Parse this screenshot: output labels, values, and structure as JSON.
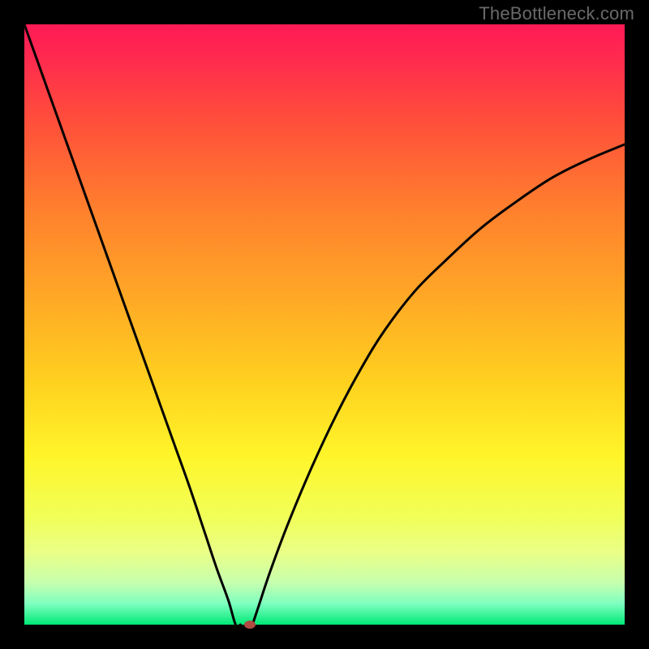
{
  "watermark": "TheBottleneck.com",
  "chart_data": {
    "type": "line",
    "title": "",
    "xlabel": "",
    "ylabel": "",
    "xlim": [
      0,
      1
    ],
    "ylim": [
      0,
      1
    ],
    "grid": false,
    "legend": false,
    "series": [
      {
        "name": "left-branch",
        "x": [
          0.0,
          0.025,
          0.05,
          0.075,
          0.1,
          0.125,
          0.15,
          0.175,
          0.2,
          0.225,
          0.25,
          0.275,
          0.3,
          0.32,
          0.34,
          0.352,
          0.36
        ],
        "y": [
          1.0,
          0.93,
          0.86,
          0.79,
          0.72,
          0.65,
          0.58,
          0.51,
          0.44,
          0.37,
          0.3,
          0.23,
          0.155,
          0.095,
          0.04,
          0.0,
          0.0
        ]
      },
      {
        "name": "right-branch",
        "x": [
          0.38,
          0.39,
          0.41,
          0.44,
          0.48,
          0.52,
          0.56,
          0.6,
          0.65,
          0.7,
          0.76,
          0.82,
          0.88,
          0.94,
          1.0
        ],
        "y": [
          0.0,
          0.03,
          0.09,
          0.17,
          0.265,
          0.35,
          0.425,
          0.49,
          0.555,
          0.605,
          0.66,
          0.705,
          0.745,
          0.775,
          0.8
        ]
      }
    ],
    "marker": {
      "x": 0.375,
      "y": 0.0
    },
    "gradient_stops": [
      {
        "pos": 0.0,
        "color": "#ff1a55"
      },
      {
        "pos": 0.05,
        "color": "#ff2850"
      },
      {
        "pos": 0.15,
        "color": "#ff4b3c"
      },
      {
        "pos": 0.3,
        "color": "#ff7d2e"
      },
      {
        "pos": 0.45,
        "color": "#ffa726"
      },
      {
        "pos": 0.6,
        "color": "#ffd21f"
      },
      {
        "pos": 0.72,
        "color": "#fff52a"
      },
      {
        "pos": 0.82,
        "color": "#f1ff58"
      },
      {
        "pos": 0.88,
        "color": "#e9ff87"
      },
      {
        "pos": 0.93,
        "color": "#c7ffae"
      },
      {
        "pos": 0.965,
        "color": "#7effc0"
      },
      {
        "pos": 1.0,
        "color": "#00e876"
      }
    ]
  }
}
